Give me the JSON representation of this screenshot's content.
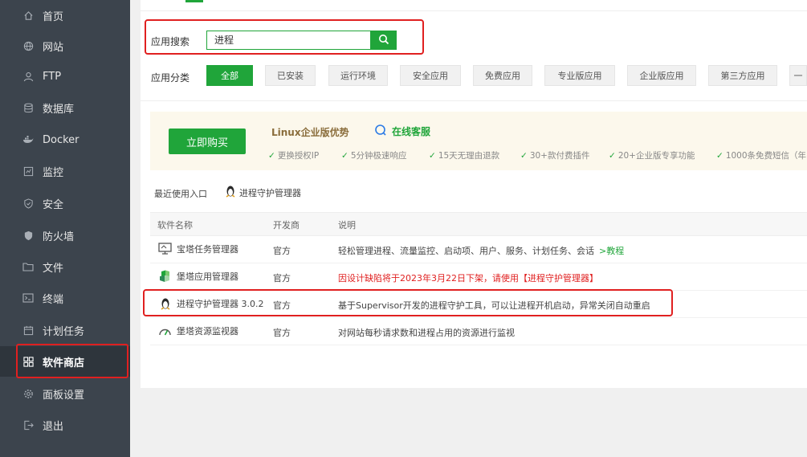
{
  "sidebar": {
    "items": [
      {
        "label": "首页",
        "icon": "home-icon"
      },
      {
        "label": "网站",
        "icon": "globe-icon"
      },
      {
        "label": "FTP",
        "icon": "user-icon"
      },
      {
        "label": "数据库",
        "icon": "database-icon"
      },
      {
        "label": "Docker",
        "icon": "docker-icon"
      },
      {
        "label": "监控",
        "icon": "monitor-icon"
      },
      {
        "label": "安全",
        "icon": "shield-icon"
      },
      {
        "label": "防火墙",
        "icon": "firewall-icon"
      },
      {
        "label": "文件",
        "icon": "folder-icon"
      },
      {
        "label": "终端",
        "icon": "terminal-icon"
      },
      {
        "label": "计划任务",
        "icon": "calendar-icon"
      },
      {
        "label": "软件商店",
        "icon": "grid-icon"
      },
      {
        "label": "面板设置",
        "icon": "gear-icon"
      },
      {
        "label": "退出",
        "icon": "logout-icon"
      }
    ],
    "active": "软件商店"
  },
  "search": {
    "label": "应用搜索",
    "value": "进程"
  },
  "categories": {
    "label": "应用分类",
    "items": [
      "全部",
      "已安装",
      "运行环境",
      "安全应用",
      "免费应用",
      "专业版应用",
      "企业版应用",
      "第三方应用",
      "一"
    ],
    "active": "全部"
  },
  "promo": {
    "buy_label": "立即购买",
    "title": "Linux企业版优势",
    "support": "在线客服",
    "features": [
      "更换授权IP",
      "5分钟极速响应",
      "15天无理由退款",
      "30+款付费插件",
      "20+企业版专享功能",
      "1000条免费短信（年"
    ]
  },
  "recent": {
    "label": "最近使用入口",
    "item": "进程守护管理器"
  },
  "table": {
    "headers": [
      "软件名称",
      "开发商",
      "说明"
    ],
    "rows": [
      {
        "name": "宝塔任务管理器",
        "dev": "官方",
        "desc": "轻松管理进程、流量监控、启动项、用户、服务、计划任务、会话",
        "link": ">教程"
      },
      {
        "name": "堡塔应用管理器",
        "dev": "官方",
        "desc": "因设计缺陷将于2023年3月22日下架，请使用【进程守护管理器】",
        "link": ""
      },
      {
        "name": "进程守护管理器 3.0.2",
        "dev": "官方",
        "desc": "基于Supervisor开发的进程守护工具，可以让进程开机启动，异常关闭自动重启",
        "link": ""
      },
      {
        "name": "堡塔资源监视器",
        "dev": "官方",
        "desc": "对网站每秒请求数和进程占用的资源进行监视",
        "link": ""
      }
    ]
  },
  "colors": {
    "accent": "#20a53a",
    "highlight": "#e02020",
    "sidebar": "#3c444d"
  }
}
